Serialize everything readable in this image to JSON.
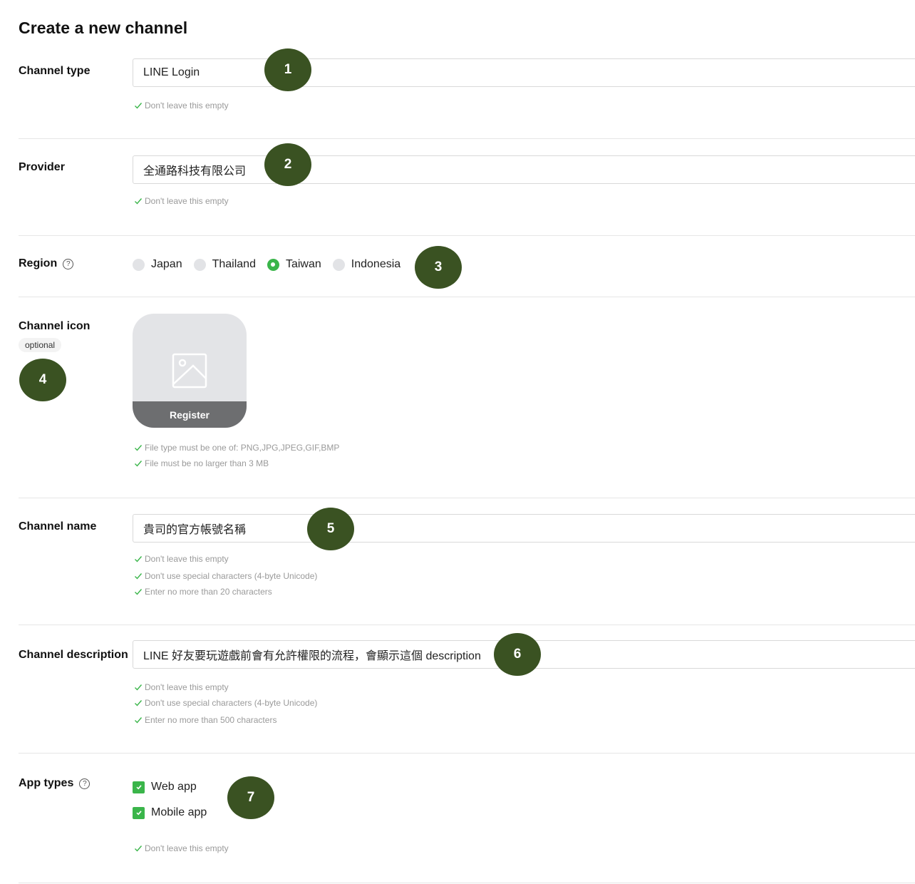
{
  "page": {
    "title": "Create a new channel"
  },
  "channel_type": {
    "label": "Channel type",
    "value": "LINE Login",
    "hints": [
      "Don't leave this empty"
    ]
  },
  "provider": {
    "label": "Provider",
    "value": "全通路科技有限公司",
    "hints": [
      "Don't leave this empty"
    ]
  },
  "region": {
    "label": "Region",
    "help_icon": "?",
    "options": [
      {
        "label": "Japan",
        "selected": false
      },
      {
        "label": "Thailand",
        "selected": false
      },
      {
        "label": "Taiwan",
        "selected": true
      },
      {
        "label": "Indonesia",
        "selected": false
      }
    ]
  },
  "channel_icon": {
    "label": "Channel icon",
    "optional": "optional",
    "register_label": "Register",
    "placeholder_icon": "image-icon",
    "hints": [
      "File type must be one of: PNG,JPG,JPEG,GIF,BMP",
      "File must be no larger than 3 MB"
    ]
  },
  "channel_name": {
    "label": "Channel name",
    "value": "貴司的官方帳號名稱",
    "hints": [
      "Don't leave this empty",
      "Don't use special characters (4-byte Unicode)",
      "Enter no more than 20 characters"
    ]
  },
  "channel_description": {
    "label": "Channel description",
    "value": "LINE 好友要玩遊戲前會有允許權限的流程，會顯示這個 description",
    "hints": [
      "Don't leave this empty",
      "Don't use special characters (4-byte Unicode)",
      "Enter no more than 500 characters"
    ]
  },
  "app_types": {
    "label": "App types",
    "help_icon": "?",
    "options": [
      {
        "label": "Web app",
        "checked": true
      },
      {
        "label": "Mobile app",
        "checked": true
      }
    ],
    "hints": [
      "Don't leave this empty"
    ]
  },
  "markers": [
    "1",
    "2",
    "3",
    "4",
    "5",
    "6",
    "7"
  ],
  "colors": {
    "accent_green": "#3ab54a",
    "marker_bg": "#3a5222",
    "hint_check": "#3ab54a",
    "register_bar": "#6d6e70"
  }
}
